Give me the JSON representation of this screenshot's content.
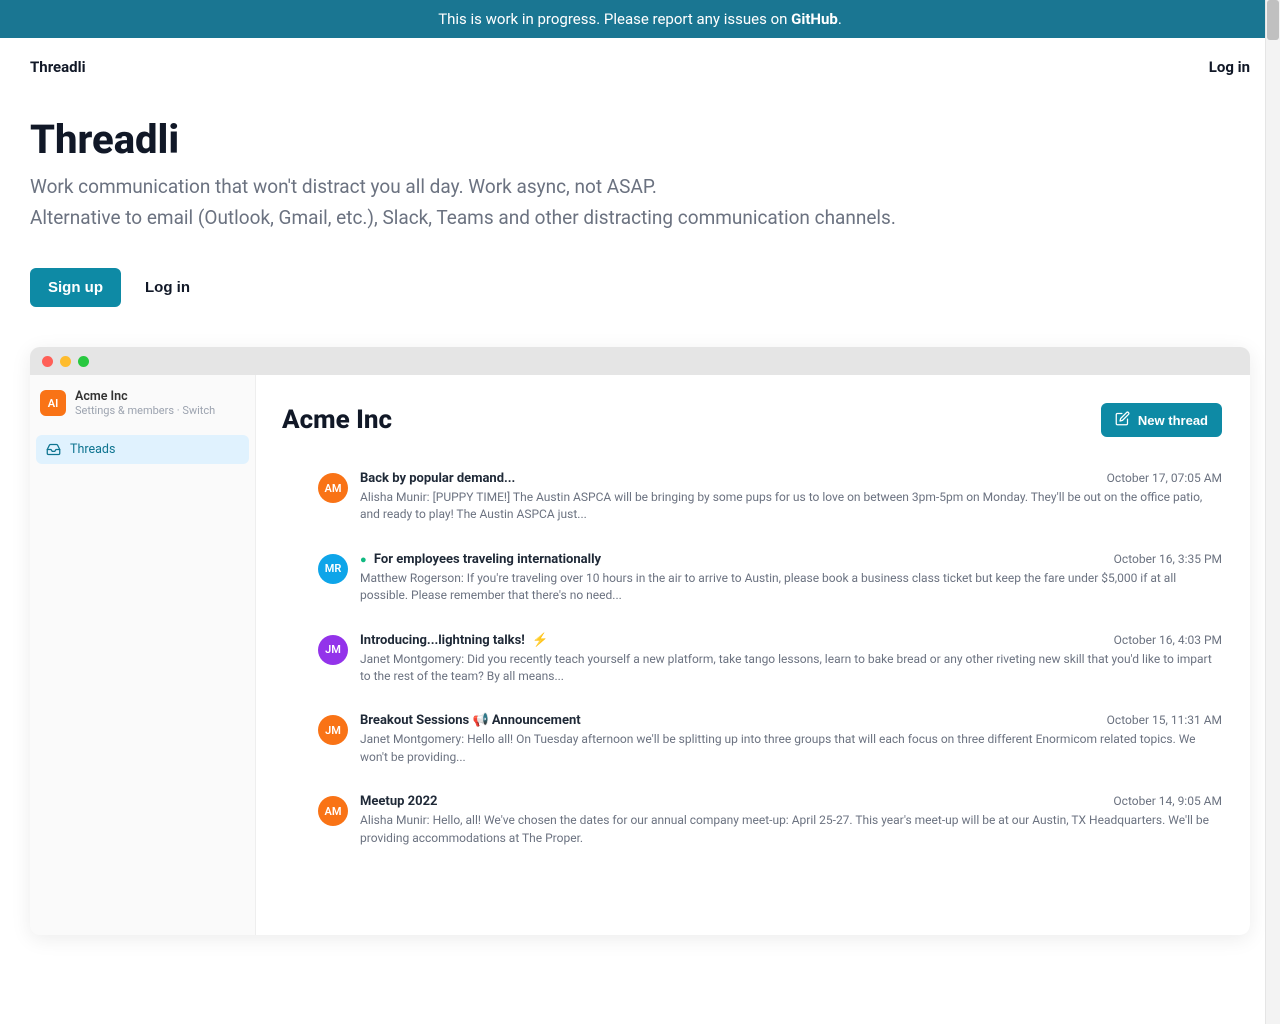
{
  "banner": {
    "text_prefix": "This is work in progress. Please report any issues on ",
    "link_text": "GitHub",
    "text_suffix": "."
  },
  "topnav": {
    "brand": "Threadli",
    "login": "Log in"
  },
  "hero": {
    "title": "Threadli",
    "tagline1": "Work communication that won't distract you all day. Work async, not ASAP.",
    "tagline2": "Alternative to email (Outlook, Gmail, etc.), Slack, Teams and other distracting communication channels.",
    "signup": "Sign up",
    "login": "Log in"
  },
  "app": {
    "sidebar": {
      "org_badge": "AI",
      "org_name": "Acme Inc",
      "org_sub": "Settings & members · Switch",
      "nav_threads": "Threads"
    },
    "main": {
      "title": "Acme Inc",
      "new_thread": "New thread",
      "threads": [
        {
          "avatar": "AM",
          "avatar_color": "#f97316",
          "title": "Back by popular demand...",
          "date": "October 17, 07:05 AM",
          "author": "Alisha Munir:",
          "preview": "  [PUPPY TIME!] The Austin ASPCA will be bringing by some pups for us to love on between 3pm-5pm on Monday. They'll be out on the office patio, and ready to play! The Austin ASPCA just..."
        },
        {
          "avatar": "MR",
          "avatar_color": "#0ea5e9",
          "title_prefix_dot": true,
          "title": "For employees traveling internationally",
          "date": "October 16, 3:35 PM",
          "author": "Matthew Rogerson:",
          "preview": "  If you're traveling over 10 hours in the air to arrive to Austin, please book a business class ticket but keep the fare under $5,000 if at all possible. Please remember that there's no need..."
        },
        {
          "avatar": "JM",
          "avatar_color": "#9333ea",
          "title": "Introducing...lightning talks!",
          "title_suffix_bolt": true,
          "date": "October 16, 4:03 PM",
          "author": "Janet Montgomery:",
          "preview": "  Did you recently teach yourself a new platform, take tango lessons, learn to bake bread or any other riveting new skill that you'd like to impart to the rest of the team? By all means..."
        },
        {
          "avatar": "JM",
          "avatar_color": "#f97316",
          "title": "Breakout Sessions 📢 Announcement",
          "date": "October 15, 11:31 AM",
          "author": "Janet Montgomery:",
          "preview": "  Hello all! On Tuesday afternoon we'll be splitting up into three groups that will each focus on three different Enormicom related topics. We won't be providing..."
        },
        {
          "avatar": "AM",
          "avatar_color": "#f97316",
          "title": "Meetup 2022",
          "date": "October 14, 9:05 AM",
          "author": "Alisha Munir:",
          "preview": "  Hello, all! We've chosen the dates for our annual company meet-up: April 25-27. This year's meet-up will be at our Austin, TX Headquarters. We'll be providing accommodations at The Proper."
        }
      ]
    }
  }
}
